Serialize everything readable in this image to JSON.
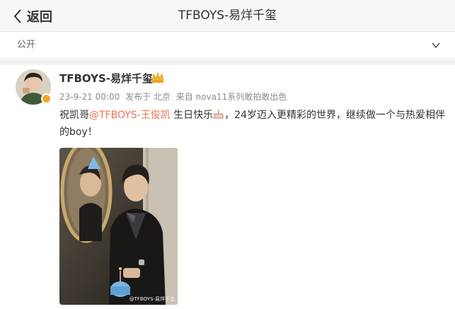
{
  "header": {
    "back_label": "返回",
    "title": "TFBOYS-易烊千玺"
  },
  "visibility": {
    "label": "公开"
  },
  "post": {
    "author": "TFBOYS-易烊千玺",
    "date": "23-9-21 00:00",
    "published_from": "发布于 北京",
    "source": "来自 nova11系列敢拍敢出色",
    "text_before": "祝凯哥",
    "mention": "@TFBOYS-王俊凯",
    "text_middle": "生日快乐",
    "text_after": "，24岁迈入更精彩的世界，继续做一个与热爱相伴的boy！",
    "image_watermark": "@TFBOYS-易烊千玺",
    "icons": [
      "verified-badge-icon",
      "crown-icon",
      "birthday-cake-icon"
    ]
  },
  "colors": {
    "mention": "#eb7350",
    "verified_badge": "#f5a623"
  }
}
